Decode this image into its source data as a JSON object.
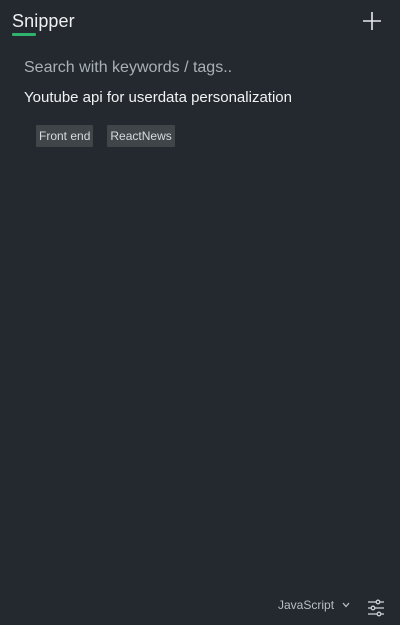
{
  "app": {
    "title": "Snipper",
    "accent_color": "#2fb26e"
  },
  "header": {
    "add_icon": "plus-icon"
  },
  "search": {
    "placeholder": "Search with keywords / tags..",
    "value": ""
  },
  "snippets": [
    {
      "title": "Youtube api for userdata personalization",
      "tags": [
        "Front end",
        "ReactNews"
      ]
    }
  ],
  "footer": {
    "language": "JavaScript",
    "language_icon": "chevron-down-icon",
    "settings_icon": "sliders-icon"
  }
}
